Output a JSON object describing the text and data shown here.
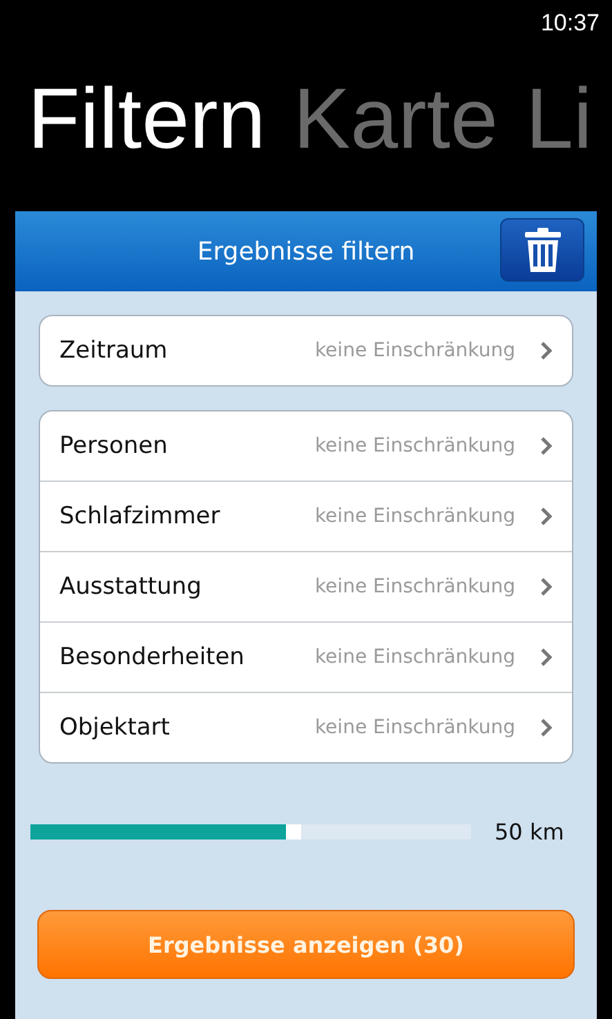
{
  "status_bar": {
    "time": "10:37"
  },
  "pivot": [
    {
      "label": "Filtern",
      "selected": true
    },
    {
      "label": "Karte",
      "selected": false
    },
    {
      "label": "Li",
      "selected": false
    }
  ],
  "panel": {
    "title": "Ergebnisse filtern"
  },
  "groups": [
    [
      {
        "label": "Zeitraum",
        "value": "keine Einschränkung"
      }
    ],
    [
      {
        "label": "Personen",
        "value": "keine Einschränkung"
      },
      {
        "label": "Schlafzimmer",
        "value": "keine Einschränkung"
      },
      {
        "label": "Ausstattung",
        "value": "keine Einschränkung"
      },
      {
        "label": "Besonderheiten",
        "value": "keine Einschränkung"
      },
      {
        "label": "Objektart",
        "value": "keine Einschränkung"
      }
    ]
  ],
  "distance": {
    "level": 0.58,
    "reading": "50 km"
  },
  "show_button": "Ergebnisse anzeigen (30)"
}
